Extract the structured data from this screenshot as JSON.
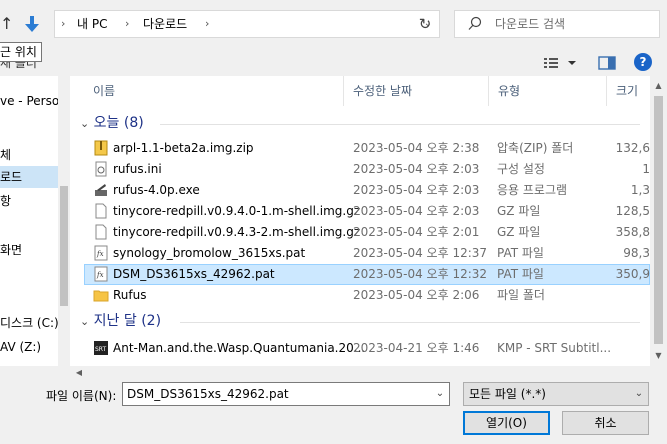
{
  "address_bar": {
    "breadcrumbs": [
      "내 PC",
      "다운로드"
    ],
    "search_placeholder": "다운로드 검색"
  },
  "toolbar": {
    "tooltip": "근 위치",
    "tail_text": "새 폴더"
  },
  "nav_pane": {
    "items": [
      {
        "label": "ve - Person",
        "selected": false
      },
      {
        "label": "체",
        "selected": false
      },
      {
        "label": "로드",
        "selected": true
      },
      {
        "label": "항",
        "selected": false
      },
      {
        "label": "화면",
        "selected": false
      },
      {
        "label": "디스크 (C:)",
        "selected": false
      },
      {
        "label": "AV (Z:)",
        "selected": false
      }
    ]
  },
  "columns": {
    "name": "이름",
    "date": "수정한 날짜",
    "type": "유형",
    "size": "크기"
  },
  "groups": [
    {
      "label": "오늘 (8)",
      "files": [
        {
          "name": "arpl-1.1-beta2a.img.zip",
          "date": "2023-05-04 오후 2:38",
          "type": "압축(ZIP) 폴더",
          "size": "132,6",
          "icon": "zip-icon",
          "selected": false
        },
        {
          "name": "rufus.ini",
          "date": "2023-05-04 오후 2:03",
          "type": "구성 설정",
          "size": "1",
          "icon": "ini-file-icon",
          "selected": false
        },
        {
          "name": "rufus-4.0p.exe",
          "date": "2023-05-04 오후 2:03",
          "type": "응용 프로그램",
          "size": "1,3",
          "icon": "exe-icon",
          "selected": false
        },
        {
          "name": "tinycore-redpill.v0.9.4.0-1.m-shell.img.gz",
          "date": "2023-05-04 오후 2:03",
          "type": "GZ 파일",
          "size": "128,5",
          "icon": "file-icon",
          "selected": false
        },
        {
          "name": "tinycore-redpill.v0.9.4.3-2.m-shell.img.gz",
          "date": "2023-05-04 오후 2:01",
          "type": "GZ 파일",
          "size": "358,8",
          "icon": "file-icon",
          "selected": false
        },
        {
          "name": "synology_bromolow_3615xs.pat",
          "date": "2023-05-04 오후 12:37",
          "type": "PAT 파일",
          "size": "98,3",
          "icon": "pat-file-icon",
          "selected": false
        },
        {
          "name": "DSM_DS3615xs_42962.pat",
          "date": "2023-05-04 오후 12:32",
          "type": "PAT 파일",
          "size": "350,9",
          "icon": "pat-file-icon",
          "selected": true
        },
        {
          "name": "Rufus",
          "date": "2023-05-04 오후 2:06",
          "type": "파일 폴더",
          "size": "",
          "icon": "folder-icon",
          "selected": false
        }
      ]
    },
    {
      "label": "지난 달 (2)",
      "files": [
        {
          "name": "Ant-Man.and.the.Wasp.Quantumania.20...",
          "date": "2023-04-21 오후 1:46",
          "type": "KMP - SRT Subtitl...",
          "size": "",
          "icon": "srt-file-icon",
          "selected": false
        }
      ]
    }
  ],
  "footer": {
    "filename_label": "파일 이름(N):",
    "filename_value": "DSM_DS3615xs_42962.pat",
    "filetype_value": "모든 파일 (*.*)",
    "open_label": "열기(O)",
    "cancel_label": "취소"
  },
  "colors": {
    "accent": "#0078d7",
    "selection": "#cce8ff",
    "group_header": "#1e3287",
    "help": "#1a64c8"
  }
}
